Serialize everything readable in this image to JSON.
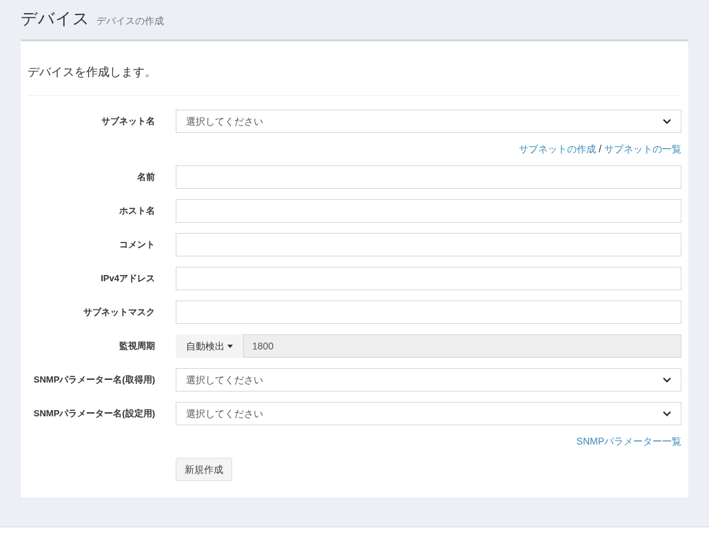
{
  "header": {
    "title": "デバイス",
    "subtitle": "デバイスの作成"
  },
  "card": {
    "intro": "デバイスを作成します。",
    "rows": [
      {
        "kind": "select",
        "label": "サブネット名",
        "placeholder": "選択してください"
      },
      {
        "kind": "links",
        "links": [
          "サブネットの作成",
          "サブネットの一覧"
        ],
        "separator": "/"
      },
      {
        "kind": "text",
        "label": "名前"
      },
      {
        "kind": "text",
        "label": "ホスト名"
      },
      {
        "kind": "text",
        "label": "コメント"
      },
      {
        "kind": "text",
        "label": "IPv4アドレス"
      },
      {
        "kind": "text",
        "label": "サブネットマスク"
      },
      {
        "kind": "interval",
        "label": "監視周期",
        "mode": "自動検出",
        "value": "1800",
        "disabled": true
      },
      {
        "kind": "select",
        "label": "SNMPパラメーター名(取得用)",
        "placeholder": "選択してください"
      },
      {
        "kind": "select",
        "label": "SNMPパラメーター名(設定用)",
        "placeholder": "選択してください"
      },
      {
        "kind": "links",
        "links": [
          "SNMPパラメーター一覧"
        ]
      },
      {
        "kind": "submit",
        "button": "新規作成"
      }
    ]
  }
}
